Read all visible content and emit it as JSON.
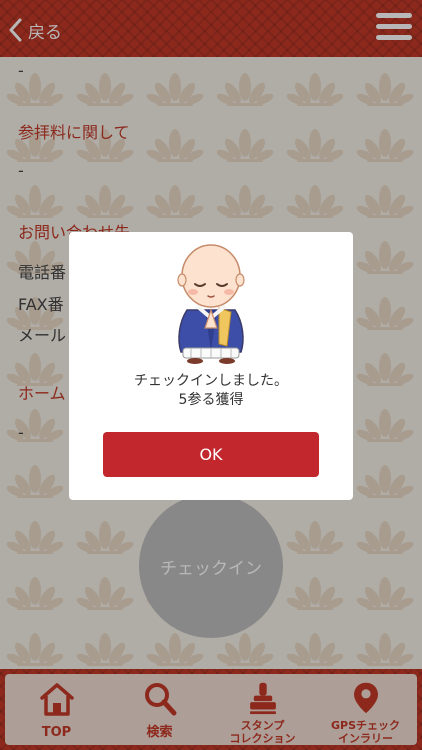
{
  "header": {
    "back_label": "戻る"
  },
  "content": {
    "dash_1": "-",
    "section_fee": "参拝料に関して",
    "dash_2": "-",
    "section_contact": "お問い合わせ先",
    "phone_label": "電話番",
    "fax_label": "FAX番",
    "mail_label": "メール",
    "section_home": "ホーム",
    "dash_3": "-",
    "checkin_label": "チェックイン"
  },
  "dialog": {
    "message_line1": "チェックインしました。",
    "message_line2": "5参る獲得",
    "ok_label": "OK"
  },
  "tabbar": {
    "items": [
      {
        "label": "TOP",
        "icon": "house-icon"
      },
      {
        "label": "検索",
        "icon": "magnifier-icon"
      },
      {
        "label": "スタンプ\nコレクション",
        "icon": "stamp-icon"
      },
      {
        "label": "GPSチェック\nインラリー",
        "icon": "map-pin-icon"
      }
    ]
  },
  "colors": {
    "brand_red": "#c23a28",
    "ok_button": "#c1272d",
    "tab_bg": "#f2dcd3",
    "checkin_gray": "#bdbdbd"
  }
}
